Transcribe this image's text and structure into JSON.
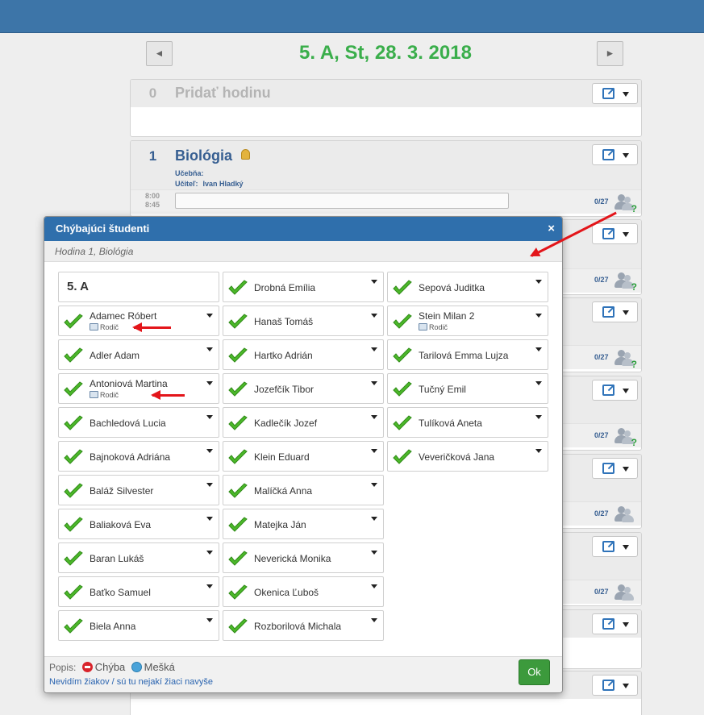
{
  "nav": {
    "prev": "◄",
    "next": "►",
    "title": "5. A, St, 28. 3. 2018"
  },
  "lessons": [
    {
      "num": "0",
      "name": "Pridať hodinu"
    },
    {
      "num": "1",
      "name": "Biológia",
      "ucebna_label": "Učebňa:",
      "ucitel_label": "Učiteľ:",
      "ucitel": "Ivan Hladký",
      "time_from": "8:00",
      "time_to": "8:45",
      "count": "0/27"
    }
  ],
  "background_counts": [
    "0/27",
    "0/27",
    "0/27",
    "0/27",
    "0/27"
  ],
  "modal": {
    "title": "Chýbajúci študenti",
    "close": "×",
    "subtitle": "Hodina 1, Biológia",
    "class_name": "5. A",
    "role_label": "Rodič",
    "columns": [
      [
        {
          "name": "Adamec Róbert",
          "role": true
        },
        {
          "name": "Adler Adam"
        },
        {
          "name": "Antoniová Martina",
          "role": true
        },
        {
          "name": "Bachledová Lucia"
        },
        {
          "name": "Bajnoková Adriána"
        },
        {
          "name": "Baláž Silvester"
        },
        {
          "name": "Baliaková Eva"
        },
        {
          "name": "Baran Lukáš"
        },
        {
          "name": "Baťko Samuel"
        },
        {
          "name": "Biela Anna"
        }
      ],
      [
        {
          "name": "Drobná Emília"
        },
        {
          "name": "Hanaš Tomáš"
        },
        {
          "name": "Hartko Adrián"
        },
        {
          "name": "Jozefčík Tibor"
        },
        {
          "name": "Kadlečík Jozef"
        },
        {
          "name": "Klein Eduard"
        },
        {
          "name": "Malíčká Anna"
        },
        {
          "name": "Matejka Ján"
        },
        {
          "name": "Neverická Monika"
        },
        {
          "name": "Okenica Ľuboš"
        },
        {
          "name": "Rozborilová Michala"
        }
      ],
      [
        {
          "name": "Sepová Juditka"
        },
        {
          "name": "Stein Milan 2",
          "role": true
        },
        {
          "name": "Tarilová Emma Lujza"
        },
        {
          "name": "Tučný Emil"
        },
        {
          "name": "Tulíková Aneta"
        },
        {
          "name": "Veveričková Jana"
        }
      ]
    ],
    "legend_label": "Popis:",
    "legend_items": [
      "Chýba",
      "Mešká"
    ],
    "footer_link": "Nevidím žiakov / sú tu nejakí žiaci navyše",
    "ok": "Ok"
  },
  "icons": [
    "edit-icon",
    "chevron-down-icon",
    "bell-icon",
    "students-icon",
    "check-icon",
    "parent-icon",
    "absent-icon",
    "late-icon",
    "close-icon",
    "annotation-arrow"
  ],
  "colors": {
    "topbar": "#3d75a8",
    "title_green": "#3aae4b",
    "lesson_blue": "#365e91",
    "modal_header": "#2f6fac",
    "ok_green": "#3c9a3c",
    "check_green": "#4cb82a",
    "arrow_red": "#e3151a"
  }
}
